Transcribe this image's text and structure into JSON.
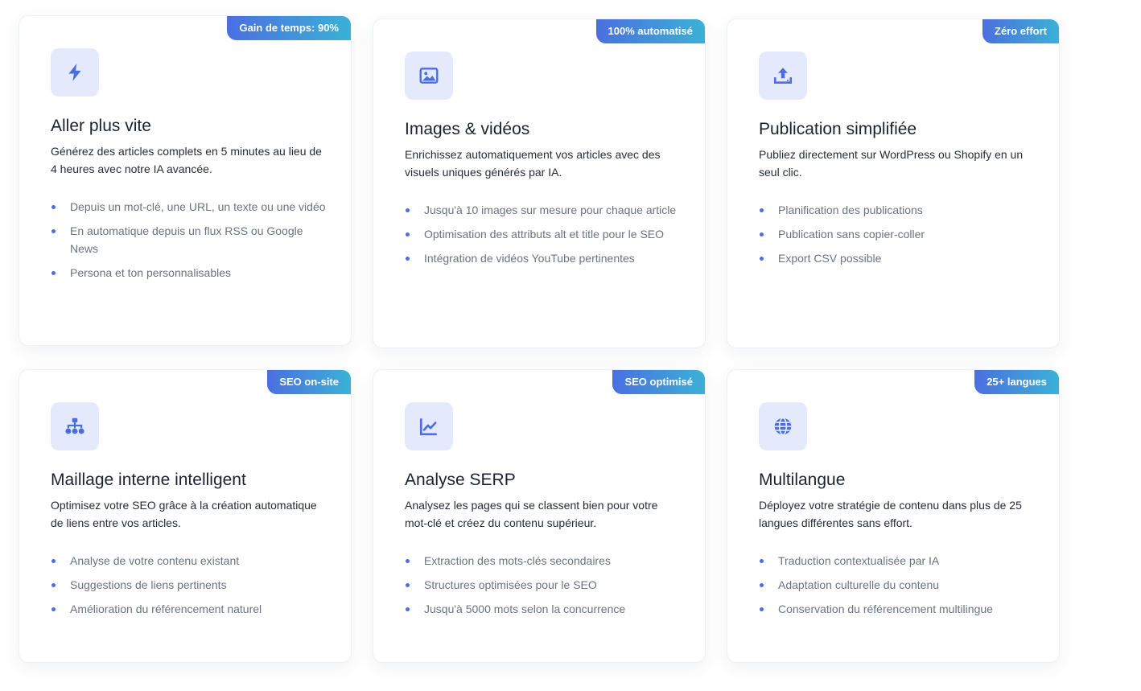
{
  "colors": {
    "accent": "#4a6ee0",
    "badge_gradient_start": "#4b6fe0",
    "badge_gradient_end": "#3bb1d6",
    "icon_background": "#e4e9fb"
  },
  "cards": [
    {
      "badge": "Gain de temps: 90%",
      "icon": "bolt-icon",
      "title": "Aller plus vite",
      "description": "Générez des articles complets en 5 minutes au lieu de 4 heures avec notre IA avancée.",
      "features": [
        "Depuis un mot-clé, une URL, un texte ou une vidéo",
        "En automatique depuis un flux RSS ou Google News",
        "Persona et ton personnalisables"
      ]
    },
    {
      "badge": "100% automatisé",
      "icon": "image-icon",
      "title": "Images & vidéos",
      "description": "Enrichissez automatiquement vos articles avec des visuels uniques générés par IA.",
      "features": [
        "Jusqu'à 10 images sur mesure pour chaque article",
        "Optimisation des attributs alt et title pour le SEO",
        "Intégration de vidéos YouTube pertinentes"
      ]
    },
    {
      "badge": "Zéro effort",
      "icon": "upload-icon",
      "title": "Publication simplifiée",
      "description": "Publiez directement sur WordPress ou Shopify en un seul clic.",
      "features": [
        "Planification des publications",
        "Publication sans copier-coller",
        "Export CSV possible"
      ]
    },
    {
      "badge": "SEO on-site",
      "icon": "sitemap-icon",
      "title": "Maillage interne intelligent",
      "description": "Optimisez votre SEO grâce à la création automatique de liens entre vos articles.",
      "features": [
        "Analyse de votre contenu existant",
        "Suggestions de liens pertinents",
        "Amélioration du référencement naturel"
      ]
    },
    {
      "badge": "SEO optimisé",
      "icon": "chart-line-icon",
      "title": "Analyse SERP",
      "description": "Analysez les pages qui se classent bien pour votre mot-clé et créez du contenu supérieur.",
      "features": [
        "Extraction des mots-clés secondaires",
        "Structures optimisées pour le SEO",
        "Jusqu'à 5000 mots selon la concurrence"
      ]
    },
    {
      "badge": "25+ langues",
      "icon": "globe-icon",
      "title": "Multilangue",
      "description": "Déployez votre stratégie de contenu dans plus de 25 langues différentes sans effort.",
      "features": [
        "Traduction contextualisée par IA",
        "Adaptation culturelle du contenu",
        "Conservation du référencement multilingue"
      ]
    }
  ]
}
